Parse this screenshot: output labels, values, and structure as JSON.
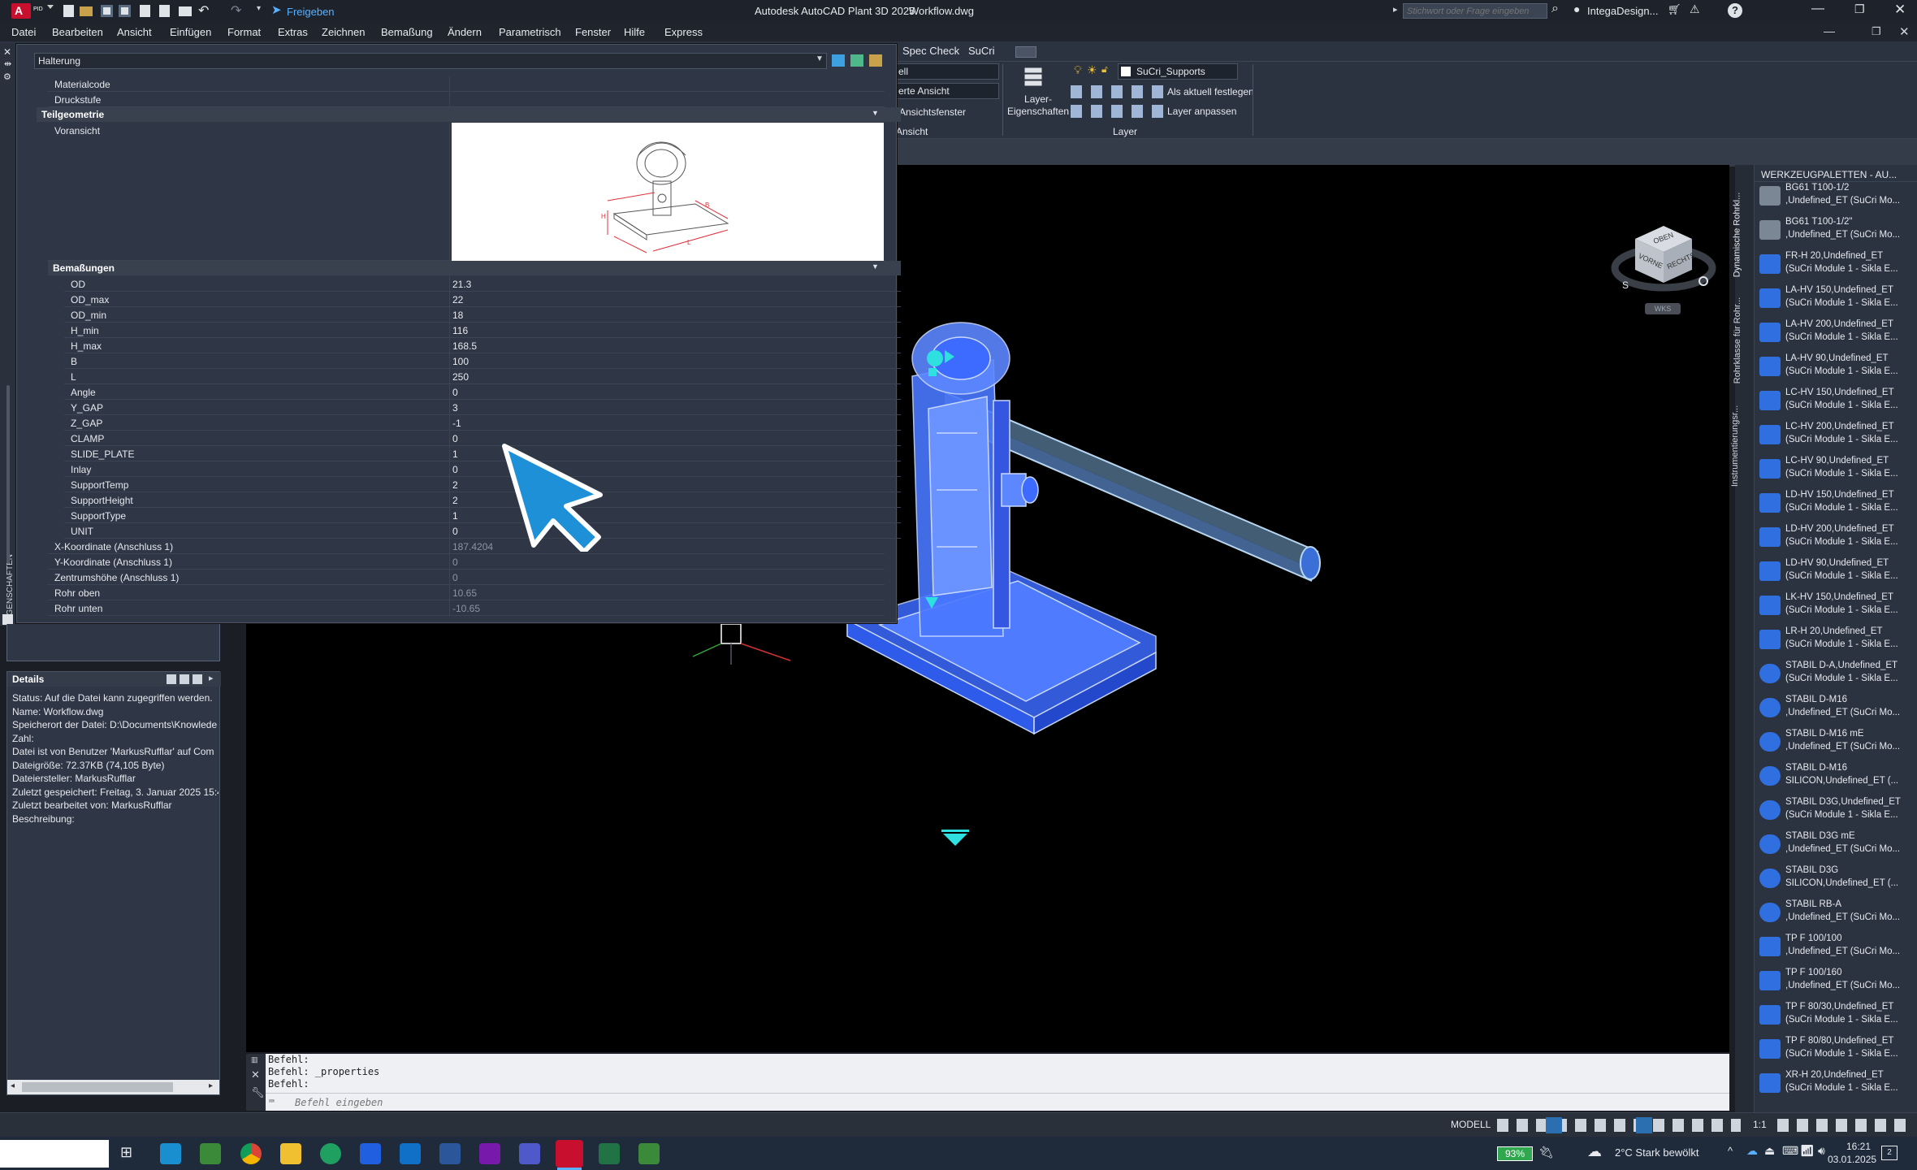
{
  "title_bar": {
    "app_badge": "A",
    "app_sub": "PID",
    "share_label": "Freigeben",
    "title": "Autodesk AutoCAD Plant 3D 2025",
    "filename": "Workflow.dwg",
    "search_placeholder": "Stichwort oder Frage eingeben",
    "user": "IntegaDesign...",
    "help": "?"
  },
  "menu": [
    "Datei",
    "Bearbeiten",
    "Ansicht",
    "Einfügen",
    "Format",
    "Extras",
    "Zeichnen",
    "Bemaßung",
    "Ändern",
    "Parametrisch",
    "Fenster",
    "Hilfe",
    "Express"
  ],
  "ribbon": {
    "tabs": [
      "Spec Check",
      "SuCri"
    ],
    "combo1": "ell",
    "combo2": "erte Ansicht",
    "viewport_label": "Ansichtsfenster",
    "view_panel": "Ansicht",
    "layer_props": "Layer-\nEigenschaften",
    "layer_combo": "SuCri_Supports",
    "set_current": "Als aktuell festlegen",
    "match_layer": "Layer anpassen",
    "layer_panel": "Layer"
  },
  "properties": {
    "palette_label": "EIGENSCHAFTEN",
    "object_type": "Halterung",
    "top_rows": [
      {
        "key": "Materialcode",
        "value": ""
      },
      {
        "key": "Druckstufe",
        "value": ""
      }
    ],
    "section_geometry": "Teilgeometrie",
    "preview_label": "Voransicht",
    "section_dimensions": "Bemaßungen",
    "dimension_rows": [
      {
        "key": "OD",
        "value": "21.3"
      },
      {
        "key": "OD_max",
        "value": "22"
      },
      {
        "key": "OD_min",
        "value": "18"
      },
      {
        "key": "H_min",
        "value": "116"
      },
      {
        "key": "H_max",
        "value": "168.5"
      },
      {
        "key": "B",
        "value": "100"
      },
      {
        "key": "L",
        "value": "250"
      },
      {
        "key": "Angle",
        "value": "0"
      },
      {
        "key": "Y_GAP",
        "value": "3"
      },
      {
        "key": "Z_GAP",
        "value": "-1"
      },
      {
        "key": "CLAMP",
        "value": "0"
      },
      {
        "key": "SLIDE_PLATE",
        "value": "1"
      },
      {
        "key": "Inlay",
        "value": "0"
      },
      {
        "key": "SupportTemp",
        "value": "2"
      },
      {
        "key": "SupportHeight",
        "value": "2"
      },
      {
        "key": "SupportType",
        "value": "1"
      },
      {
        "key": "UNIT",
        "value": "0"
      }
    ],
    "extra_rows": [
      {
        "key": "X-Koordinate (Anschluss 1)",
        "value": "187.4204"
      },
      {
        "key": "Y-Koordinate (Anschluss 1)",
        "value": "0"
      },
      {
        "key": "Zentrumshöhe (Anschluss 1)",
        "value": "0"
      },
      {
        "key": "Rohr oben",
        "value": "10.65"
      },
      {
        "key": "Rohr unten",
        "value": "-10.65"
      }
    ]
  },
  "details": {
    "title": "Details",
    "lines": [
      "Status: Auf die Datei kann zugegriffen werden.",
      "Name: Workflow.dwg",
      "Speicherort der Datei: D:\\Documents\\Knowlede",
      "Zahl:",
      "Datei ist von Benutzer 'MarkusRufflar' auf Com",
      "Dateigröße: 72.37KB (74,105 Byte)",
      "Dateiersteller: MarkusRufflar",
      "Zuletzt gespeichert: Freitag, 3. Januar 2025 15:4",
      "Zuletzt bearbeitet von: MarkusRufflar",
      "Beschreibung:"
    ]
  },
  "viewcube": {
    "top": "OBEN",
    "front": "VORNE",
    "right": "RECHTS",
    "south": "S",
    "wcs": "WKS"
  },
  "tool_palette": {
    "title": "WERKZEUGPALETTEN - AU...",
    "side_tabs": [
      "Dynamische Rohrkl...",
      "Rohrklasse für Rohr...",
      "Instrumentierungsr..."
    ],
    "items": [
      {
        "line1": "BG61 T100-1/2",
        "line2": ",Undefined_ET (SuCri Mo..."
      },
      {
        "line1": "BG61 T100-1/2\"",
        "line2": ",Undefined_ET (SuCri Mo..."
      },
      {
        "line1": "FR-H 20,Undefined_ET",
        "line2": "(SuCri Module 1 - Sikla E..."
      },
      {
        "line1": "LA-HV 150,Undefined_ET",
        "line2": "(SuCri Module 1 - Sikla E..."
      },
      {
        "line1": "LA-HV 200,Undefined_ET",
        "line2": "(SuCri Module 1 - Sikla E..."
      },
      {
        "line1": "LA-HV 90,Undefined_ET",
        "line2": "(SuCri Module 1 - Sikla E..."
      },
      {
        "line1": "LC-HV 150,Undefined_ET",
        "line2": "(SuCri Module 1 - Sikla E..."
      },
      {
        "line1": "LC-HV 200,Undefined_ET",
        "line2": "(SuCri Module 1 - Sikla E..."
      },
      {
        "line1": "LC-HV 90,Undefined_ET",
        "line2": "(SuCri Module 1 - Sikla E..."
      },
      {
        "line1": "LD-HV 150,Undefined_ET",
        "line2": "(SuCri Module 1 - Sikla E..."
      },
      {
        "line1": "LD-HV 200,Undefined_ET",
        "line2": "(SuCri Module 1 - Sikla E..."
      },
      {
        "line1": "LD-HV 90,Undefined_ET",
        "line2": "(SuCri Module 1 - Sikla E..."
      },
      {
        "line1": "LK-HV 150,Undefined_ET",
        "line2": "(SuCri Module 1 - Sikla E..."
      },
      {
        "line1": "LR-H 20,Undefined_ET",
        "line2": "(SuCri Module 1 - Sikla E..."
      },
      {
        "line1": "STABIL D-A,Undefined_ET",
        "line2": "(SuCri Module 1 - Sikla E..."
      },
      {
        "line1": "STABIL D-M16",
        "line2": ",Undefined_ET (SuCri Mo..."
      },
      {
        "line1": "STABIL D-M16 mE",
        "line2": ",Undefined_ET (SuCri Mo..."
      },
      {
        "line1": "STABIL D-M16",
        "line2": "SILICON,Undefined_ET (..."
      },
      {
        "line1": "STABIL D3G,Undefined_ET",
        "line2": "(SuCri Module 1 - Sikla E..."
      },
      {
        "line1": "STABIL D3G mE",
        "line2": ",Undefined_ET (SuCri Mo..."
      },
      {
        "line1": "STABIL D3G",
        "line2": "SILICON,Undefined_ET (..."
      },
      {
        "line1": "STABIL RB-A",
        "line2": ",Undefined_ET (SuCri Mo..."
      },
      {
        "line1": "TP F 100/100",
        "line2": ",Undefined_ET (SuCri Mo..."
      },
      {
        "line1": "TP F 100/160",
        "line2": ",Undefined_ET (SuCri Mo..."
      },
      {
        "line1": "TP F 80/30,Undefined_ET",
        "line2": "(SuCri Module 1 - Sikla E..."
      },
      {
        "line1": "TP F 80/80,Undefined_ET",
        "line2": "(SuCri Module 1 - Sikla E..."
      },
      {
        "line1": "XR-H 20,Undefined_ET",
        "line2": "(SuCri Module 1 - Sikla E..."
      }
    ]
  },
  "command": {
    "history": [
      "Befehl:",
      "Befehl: _properties",
      "Befehl:"
    ],
    "placeholder": "Befehl eingeben"
  },
  "status": {
    "model": "MODELL",
    "scale": "1:1"
  },
  "taskbar": {
    "battery": "93%",
    "weather": "2°C  Stark bewölkt",
    "time": "16:21",
    "date": "03.01.2025",
    "notif": "2"
  },
  "colors": {
    "accent": "#1e90d8",
    "selection": "#3d6bff",
    "viewport": "#000000",
    "panel": "#2f3746"
  }
}
